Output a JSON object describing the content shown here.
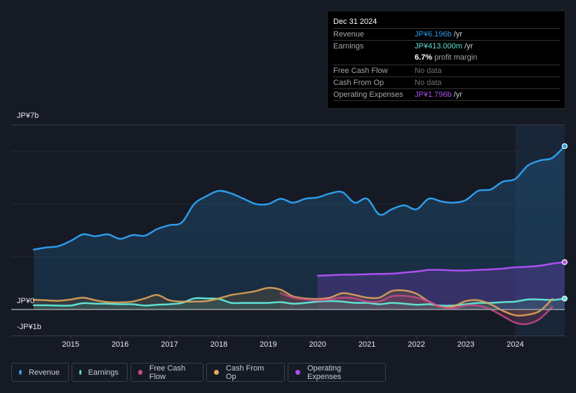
{
  "tooltip": {
    "date": "Dec 31 2024",
    "rows": [
      {
        "label": "Revenue",
        "value": "JP¥6.196b",
        "unit": " /yr",
        "color": "#2e9be8"
      },
      {
        "label": "Earnings",
        "value": "JP¥413.000m",
        "unit": " /yr",
        "color": "#5ee0d0"
      },
      {
        "label": "",
        "value": "6.7%",
        "unit": " profit margin",
        "color": "#ffffff"
      },
      {
        "label": "Free Cash Flow",
        "value": "No data",
        "unit": "",
        "color": "#6b7078"
      },
      {
        "label": "Cash From Op",
        "value": "No data",
        "unit": "",
        "color": "#6b7078"
      },
      {
        "label": "Operating Expenses",
        "value": "JP¥1.796b",
        "unit": " /yr",
        "color": "#a950f0"
      }
    ]
  },
  "legend": [
    {
      "label": "Revenue",
      "color": "#2e9be8"
    },
    {
      "label": "Earnings",
      "color": "#5ee0d0"
    },
    {
      "label": "Free Cash Flow",
      "color": "#c84a8a"
    },
    {
      "label": "Cash From Op",
      "color": "#e8a85a"
    },
    {
      "label": "Operating Expenses",
      "color": "#a950f0"
    }
  ],
  "chart_data": {
    "type": "area",
    "title": "",
    "xlabel": "",
    "ylabel": "",
    "y_unit": "JP¥ billions",
    "ylim": [
      -1,
      7
    ],
    "xlim": [
      2014.25,
      2025.0
    ],
    "y_tick_labels": [
      {
        "value": 7,
        "label": "JP¥7b"
      },
      {
        "value": 0,
        "label": "JP¥0"
      },
      {
        "value": -1,
        "label": "-JP¥1b"
      }
    ],
    "gridlines": [
      6,
      4,
      2
    ],
    "x_tick_labels": [
      "2015",
      "2016",
      "2017",
      "2018",
      "2019",
      "2020",
      "2021",
      "2022",
      "2023",
      "2024"
    ],
    "x_ticks": [
      2015,
      2016,
      2017,
      2018,
      2019,
      2020,
      2021,
      2022,
      2023,
      2024
    ],
    "highlight_from": 2024.0,
    "grid": true,
    "legend_position": "bottom-left",
    "series": [
      {
        "name": "Revenue",
        "color": "#2e9be8",
        "x": [
          2014.25,
          2014.5,
          2014.75,
          2015.0,
          2015.25,
          2015.5,
          2015.75,
          2016.0,
          2016.25,
          2016.5,
          2016.75,
          2017.0,
          2017.25,
          2017.5,
          2017.75,
          2018.0,
          2018.25,
          2018.5,
          2018.75,
          2019.0,
          2019.25,
          2019.5,
          2019.75,
          2020.0,
          2020.25,
          2020.5,
          2020.75,
          2021.0,
          2021.25,
          2021.5,
          2021.75,
          2022.0,
          2022.25,
          2022.5,
          2022.75,
          2023.0,
          2023.25,
          2023.5,
          2023.75,
          2024.0,
          2024.25,
          2024.5,
          2024.75,
          2025.0
        ],
        "values": [
          2.27,
          2.35,
          2.4,
          2.6,
          2.85,
          2.78,
          2.85,
          2.68,
          2.82,
          2.8,
          3.05,
          3.2,
          3.3,
          4.0,
          4.3,
          4.5,
          4.4,
          4.2,
          4.0,
          4.0,
          4.2,
          4.05,
          4.2,
          4.25,
          4.4,
          4.45,
          4.05,
          4.2,
          3.6,
          3.8,
          3.95,
          3.8,
          4.2,
          4.1,
          4.05,
          4.15,
          4.5,
          4.55,
          4.85,
          4.95,
          5.45,
          5.65,
          5.75,
          6.196
        ]
      },
      {
        "name": "Earnings",
        "color": "#5ee0d0",
        "x": [
          2014.25,
          2014.5,
          2014.75,
          2015.0,
          2015.25,
          2015.5,
          2015.75,
          2016.0,
          2016.25,
          2016.5,
          2016.75,
          2017.0,
          2017.25,
          2017.5,
          2017.75,
          2018.0,
          2018.25,
          2018.5,
          2018.75,
          2019.0,
          2019.25,
          2019.5,
          2019.75,
          2020.0,
          2020.25,
          2020.5,
          2020.75,
          2021.0,
          2021.25,
          2021.5,
          2021.75,
          2022.0,
          2022.25,
          2022.5,
          2022.75,
          2023.0,
          2023.25,
          2023.5,
          2023.75,
          2024.0,
          2024.25,
          2024.5,
          2024.75,
          2025.0
        ],
        "values": [
          0.16,
          0.16,
          0.15,
          0.15,
          0.24,
          0.22,
          0.22,
          0.2,
          0.2,
          0.15,
          0.18,
          0.2,
          0.25,
          0.42,
          0.42,
          0.4,
          0.25,
          0.25,
          0.25,
          0.25,
          0.28,
          0.22,
          0.25,
          0.3,
          0.32,
          0.3,
          0.25,
          0.25,
          0.2,
          0.25,
          0.22,
          0.18,
          0.2,
          0.15,
          0.15,
          0.2,
          0.25,
          0.25,
          0.28,
          0.3,
          0.38,
          0.38,
          0.36,
          0.413
        ]
      },
      {
        "name": "Free Cash Flow",
        "color": "#c84a8a",
        "x": [
          2019.25,
          2019.5,
          2019.75,
          2020.0,
          2020.25,
          2020.5,
          2020.75,
          2021.0,
          2021.25,
          2021.5,
          2021.75,
          2022.0,
          2022.25,
          2022.5,
          2022.75,
          2023.0,
          2023.25,
          2023.5,
          2023.75,
          2024.0,
          2024.25,
          2024.5,
          2024.75
        ],
        "values": [
          0.62,
          0.45,
          0.38,
          0.35,
          0.38,
          0.45,
          0.42,
          0.3,
          0.3,
          0.5,
          0.52,
          0.45,
          0.3,
          0.1,
          0.05,
          0.15,
          0.15,
          0.0,
          -0.25,
          -0.5,
          -0.55,
          -0.35,
          0.1
        ]
      },
      {
        "name": "Cash From Op",
        "color": "#e8a85a",
        "x": [
          2014.25,
          2014.5,
          2014.75,
          2015.0,
          2015.25,
          2015.5,
          2015.75,
          2016.0,
          2016.25,
          2016.5,
          2016.75,
          2017.0,
          2017.25,
          2017.5,
          2017.75,
          2018.0,
          2018.25,
          2018.5,
          2018.75,
          2019.0,
          2019.25,
          2019.5,
          2019.75,
          2020.0,
          2020.25,
          2020.5,
          2020.75,
          2021.0,
          2021.25,
          2021.5,
          2021.75,
          2022.0,
          2022.25,
          2022.5,
          2022.75,
          2023.0,
          2023.25,
          2023.5,
          2023.75,
          2024.0,
          2024.25,
          2024.5,
          2024.75
        ],
        "values": [
          0.37,
          0.35,
          0.33,
          0.38,
          0.45,
          0.35,
          0.28,
          0.27,
          0.3,
          0.42,
          0.55,
          0.35,
          0.3,
          0.3,
          0.32,
          0.42,
          0.55,
          0.62,
          0.7,
          0.82,
          0.75,
          0.5,
          0.42,
          0.4,
          0.45,
          0.62,
          0.55,
          0.45,
          0.45,
          0.7,
          0.72,
          0.6,
          0.3,
          0.1,
          0.12,
          0.32,
          0.35,
          0.2,
          -0.05,
          -0.22,
          -0.2,
          -0.05,
          0.4
        ]
      },
      {
        "name": "Operating Expenses",
        "color": "#a950f0",
        "x": [
          2020.0,
          2020.25,
          2020.5,
          2020.75,
          2021.0,
          2021.25,
          2021.5,
          2021.75,
          2022.0,
          2022.25,
          2022.5,
          2022.75,
          2023.0,
          2023.25,
          2023.5,
          2023.75,
          2024.0,
          2024.25,
          2024.5,
          2024.75,
          2025.0
        ],
        "values": [
          1.28,
          1.3,
          1.32,
          1.32,
          1.34,
          1.35,
          1.36,
          1.4,
          1.44,
          1.5,
          1.5,
          1.48,
          1.48,
          1.5,
          1.52,
          1.55,
          1.6,
          1.62,
          1.66,
          1.74,
          1.796
        ]
      }
    ]
  }
}
